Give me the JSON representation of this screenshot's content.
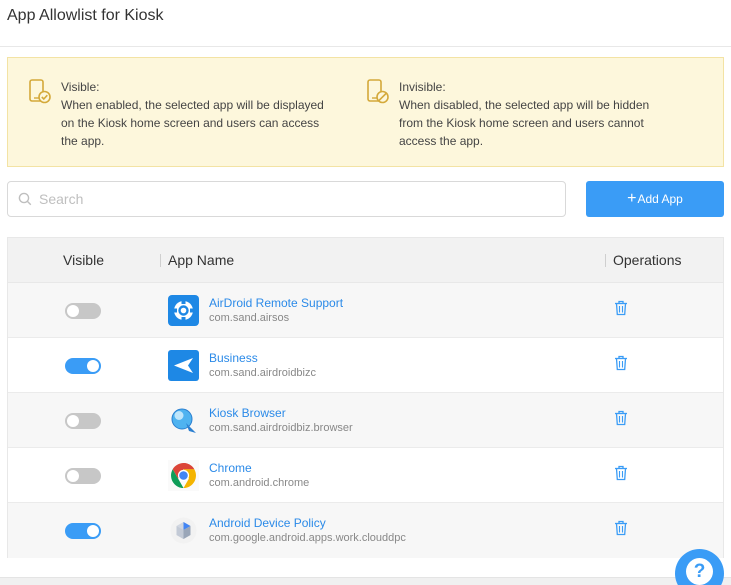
{
  "header": {
    "title": "App Allowlist for Kiosk"
  },
  "notice": {
    "visible": {
      "icon": "phone-check-icon",
      "title": "Visible:",
      "lines": [
        "When enabled, the selected app will be displayed",
        "on the Kiosk home screen and users can access",
        "the app."
      ]
    },
    "invisible": {
      "icon": "phone-block-icon",
      "title": "Invisible:",
      "lines": [
        "When disabled, the selected app will be hidden",
        "from the Kiosk home screen and users cannot",
        "access the app."
      ]
    }
  },
  "search": {
    "placeholder": "Search",
    "value": ""
  },
  "toolbar": {
    "add_app_label": "Add App",
    "add_icon": "+"
  },
  "table": {
    "columns": {
      "visible": "Visible",
      "app_name": "App Name",
      "operations": "Operations"
    },
    "rows": [
      {
        "name": "AirDroid Remote Support",
        "package": "com.sand.airsos",
        "visible": false,
        "icon": "airdroid-remote-support-icon"
      },
      {
        "name": "Business",
        "package": "com.sand.airdroidbizc",
        "visible": true,
        "icon": "business-icon"
      },
      {
        "name": "Kiosk Browser",
        "package": "com.sand.airdroidbiz.browser",
        "visible": false,
        "icon": "kiosk-browser-icon"
      },
      {
        "name": "Chrome",
        "package": "com.android.chrome",
        "visible": false,
        "icon": "chrome-icon"
      },
      {
        "name": "Android Device Policy",
        "package": "com.google.android.apps.work.clouddpc",
        "visible": true,
        "icon": "android-device-policy-icon"
      }
    ]
  },
  "help": {
    "label": "?"
  },
  "colors": {
    "accent": "#3a9cf6",
    "link": "#2b8ae8",
    "notice_bg": "#fdf7dc",
    "toggle_off": "#c7c7c7"
  }
}
